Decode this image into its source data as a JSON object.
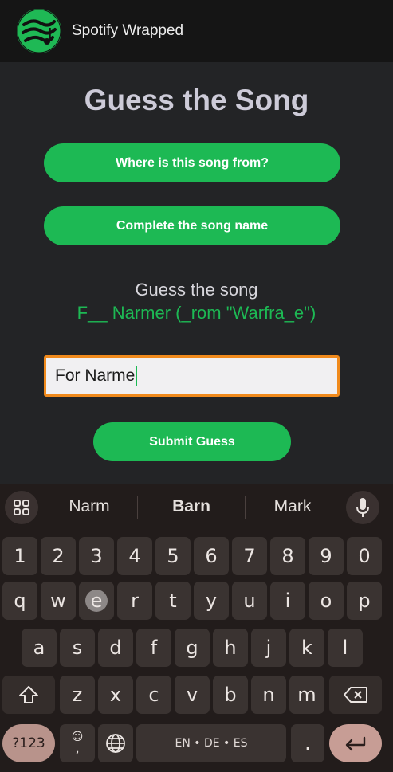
{
  "app_bar": {
    "title": "Spotify Wrapped",
    "logo_icon": "spotify-wrapped-logo-icon"
  },
  "game": {
    "heading": "Guess the Song",
    "option_1": "Where is this song from?",
    "option_2": "Complete the song name",
    "prompt": "Guess the song",
    "hint": "F__ Narmer (_rom \"Warfra_e\")",
    "input_value": "For Narme",
    "submit_label": "Submit Guess"
  },
  "keyboard": {
    "suggestions": [
      "Narm",
      "Barn",
      "Mark"
    ],
    "row_numbers": [
      "1",
      "2",
      "3",
      "4",
      "5",
      "6",
      "7",
      "8",
      "9",
      "0"
    ],
    "row_1": [
      "q",
      "w",
      "e",
      "r",
      "t",
      "y",
      "u",
      "i",
      "o",
      "p"
    ],
    "row_2": [
      "a",
      "s",
      "d",
      "f",
      "g",
      "h",
      "j",
      "k",
      "l"
    ],
    "row_3": [
      "z",
      "x",
      "c",
      "v",
      "b",
      "n",
      "m"
    ],
    "symbols_label": "?123",
    "comma": ",",
    "period": ".",
    "space_label": "EN • DE • ES"
  },
  "colors": {
    "accent": "#1db954",
    "input_border": "#f08a1c",
    "background": "#232426"
  }
}
